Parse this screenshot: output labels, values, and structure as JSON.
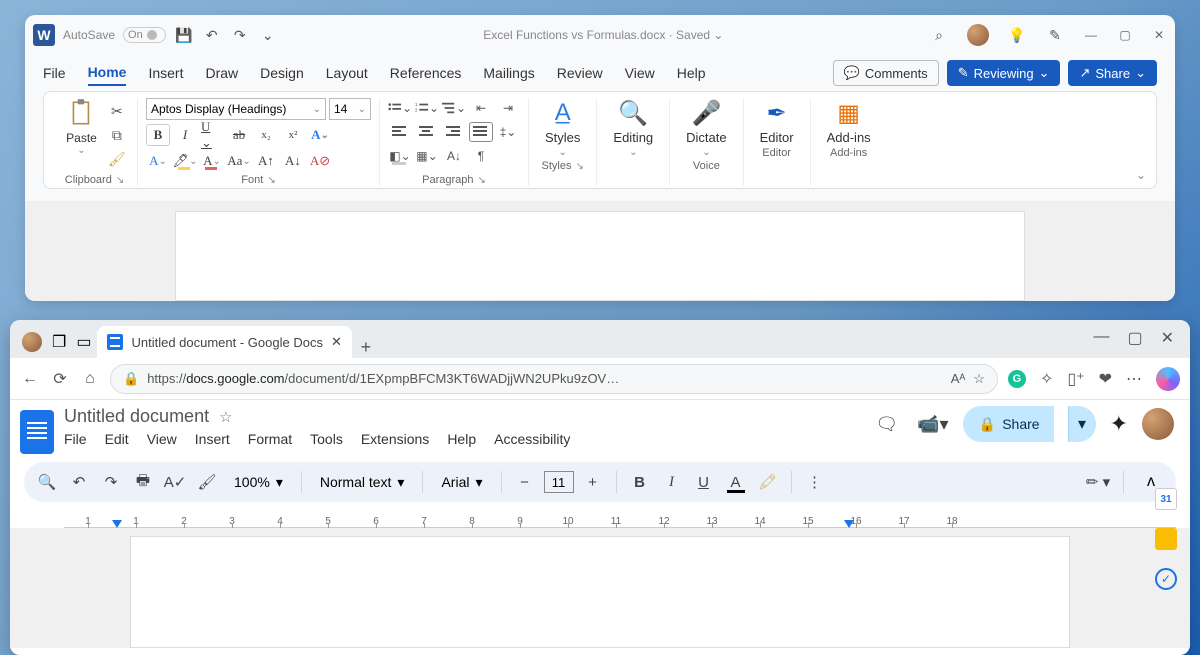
{
  "word": {
    "autosave_label": "AutoSave",
    "autosave_state": "On",
    "doc_title": "Excel Functions vs Formulas.docx",
    "save_state": "Saved",
    "menu": [
      "File",
      "Home",
      "Insert",
      "Draw",
      "Design",
      "Layout",
      "References",
      "Mailings",
      "Review",
      "View",
      "Help"
    ],
    "active_menu": "Home",
    "comments_btn": "Comments",
    "track_mode": "Reviewing",
    "share_btn": "Share",
    "font_name": "Aptos Display (Headings)",
    "font_size": "14",
    "groups": {
      "clipboard": "Clipboard",
      "paste": "Paste",
      "font": "Font",
      "paragraph": "Paragraph",
      "styles": "Styles",
      "editing": "Editing",
      "voice": "Voice",
      "dictate": "Dictate",
      "editor_group": "Editor",
      "editor": "Editor",
      "addins_group": "Add-ins",
      "addins": "Add-ins"
    }
  },
  "browser": {
    "tab_title": "Untitled document - Google Docs",
    "url_prefix": "https://",
    "url_host": "docs.google.com",
    "url_path": "/document/d/1EXpmpBFCM3KT6WADjjWN2UPku9zOV…"
  },
  "docs": {
    "title": "Untitled document",
    "menu": [
      "File",
      "Edit",
      "View",
      "Insert",
      "Format",
      "Tools",
      "Extensions",
      "Help",
      "Accessibility"
    ],
    "share": "Share",
    "zoom": "100%",
    "style_select": "Normal text",
    "font_family": "Arial",
    "font_size": "11",
    "ruler": [
      "1",
      "1",
      "2",
      "3",
      "4",
      "5",
      "6",
      "7",
      "8",
      "9",
      "10",
      "11",
      "12",
      "13",
      "14",
      "15",
      "16",
      "17",
      "18"
    ],
    "calendar_day": "31"
  }
}
